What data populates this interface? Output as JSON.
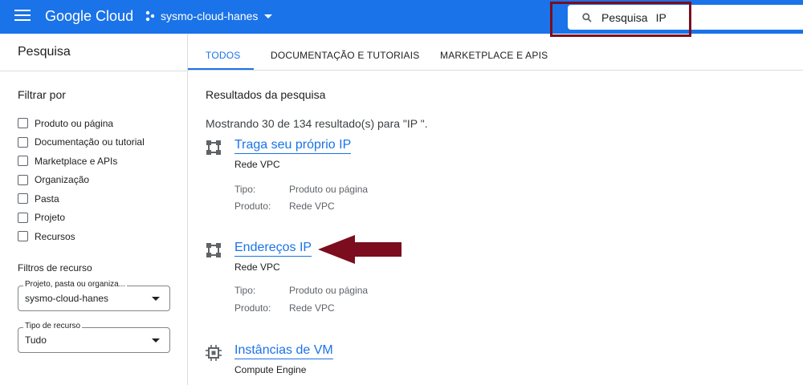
{
  "header": {
    "brand": "Google Cloud",
    "project": "sysmo-cloud-hanes",
    "search_label": "Pesquisa",
    "search_query": "IP"
  },
  "sidebar": {
    "title": "Pesquisa",
    "filter_heading": "Filtrar por",
    "filters": [
      {
        "label": "Produto ou página"
      },
      {
        "label": "Documentação ou tutorial"
      },
      {
        "label": "Marketplace e APIs"
      },
      {
        "label": "Organização"
      },
      {
        "label": "Pasta"
      },
      {
        "label": "Projeto"
      },
      {
        "label": "Recursos"
      }
    ],
    "resource_heading": "Filtros de recurso",
    "selects": [
      {
        "label": "Projeto, pasta ou organiza...",
        "value": "sysmo-cloud-hanes"
      },
      {
        "label": "Tipo de recurso",
        "value": "Tudo"
      }
    ]
  },
  "tabs": [
    {
      "label": "TODOS"
    },
    {
      "label": "DOCUMENTAÇÃO E TUTORIAIS"
    },
    {
      "label": "MARKETPLACE E APIS"
    }
  ],
  "results": {
    "title": "Resultados da pesquisa",
    "count_text": "Mostrando 30 de 134 resultado(s) para \"IP \".",
    "items": [
      {
        "title": "Traga seu próprio IP",
        "subtitle": "Rede VPC",
        "type_label": "Tipo:",
        "type": "Produto ou página",
        "product_label": "Produto:",
        "product": "Rede VPC",
        "icon": "network-icon"
      },
      {
        "title": "Endereços IP",
        "subtitle": "Rede VPC",
        "type_label": "Tipo:",
        "type": "Produto ou página",
        "product_label": "Produto:",
        "product": "Rede VPC",
        "icon": "network-icon"
      },
      {
        "title": "Instâncias de VM",
        "subtitle": "Compute Engine",
        "icon": "chip-icon"
      }
    ]
  },
  "colors": {
    "accent": "#1a73e8",
    "annotation": "#7b0d1e"
  }
}
